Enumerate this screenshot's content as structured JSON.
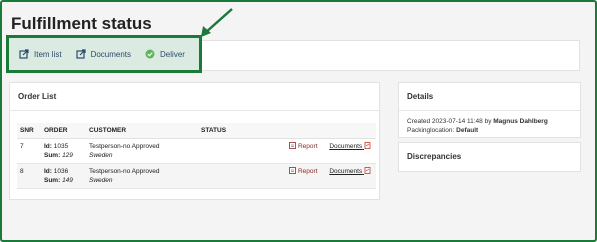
{
  "page": {
    "title": "Fulfillment status"
  },
  "toolbar": {
    "item_list_label": "Item list",
    "documents_label": "Documents",
    "deliver_label": "Deliver"
  },
  "order_list": {
    "title": "Order List",
    "columns": [
      "SNR",
      "ORDER",
      "CUSTOMER",
      "STATUS"
    ],
    "rows": [
      {
        "snr": "7",
        "id_label": "Id:",
        "id": "1035",
        "sum_label": "Sum:",
        "sum": "129",
        "customer": "Testperson-no Approved",
        "country": "Sweden",
        "report": "Report",
        "documents": "Documents"
      },
      {
        "snr": "8",
        "id_label": "Id:",
        "id": "1036",
        "sum_label": "Sum:",
        "sum": "149",
        "customer": "Testperson-no Approved",
        "country": "Sweden",
        "report": "Report",
        "documents": "Documents"
      }
    ]
  },
  "details": {
    "title": "Details",
    "created_prefix": "Created 2023-07-14 11:48 by",
    "created_by": "Magnus Dahlberg",
    "packing_prefix": "Packinglocation:",
    "packing_location": "Default"
  },
  "discrepancies": {
    "title": "Discrepancies"
  },
  "colors": {
    "highlight_border": "#1a7a3a",
    "highlight_fill": "#dcebe2",
    "link_blue": "#2c4a6e",
    "report_red": "#8b2a2a",
    "success_green": "#5cb85c"
  }
}
